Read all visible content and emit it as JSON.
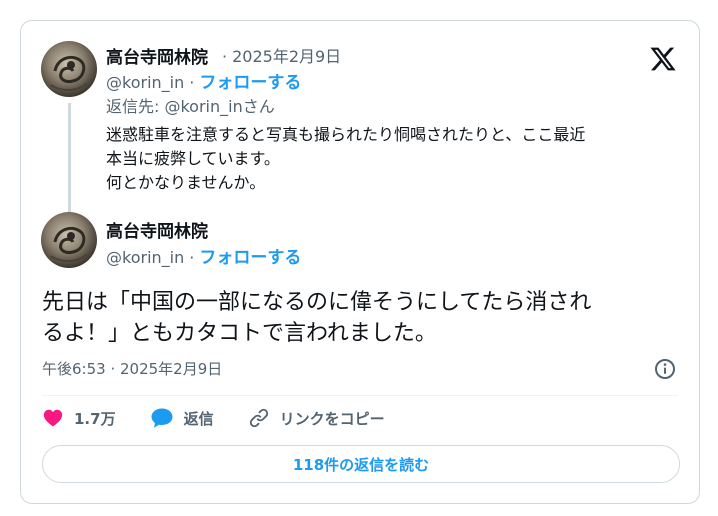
{
  "reply_tweet": {
    "display_name": "高台寺岡林院",
    "date": "2025年2月9日",
    "handle": "@korin_in",
    "follow_label": "フォローする",
    "separator": "·",
    "reply_to": "返信先: @korin_inさん",
    "text_lines": [
      "迷惑駐車を注意すると写真も撮られたり恫喝されたりと、ここ最近",
      "本当に疲弊しています。",
      "何とかなりませんか。"
    ]
  },
  "main_tweet": {
    "display_name": "高台寺岡林院",
    "handle": "@korin_in",
    "follow_label": "フォローする",
    "separator": "·",
    "text_lines": [
      "先日は「中国の一部になるのに偉そうにしてたら消され",
      "るよ！」ともカタコトで言われました。"
    ],
    "timestamp": "午後6:53 · 2025年2月9日"
  },
  "actions": {
    "like_count": "1.7万",
    "reply_label": "返信",
    "copy_link_label": "リンクをコピー"
  },
  "read_replies_label": "118件の返信を読む",
  "icons": {
    "brand": "x-logo-icon",
    "like": "heart-icon",
    "reply": "speech-bubble-icon",
    "copy_link": "link-icon",
    "info": "info-icon"
  },
  "colors": {
    "accent": "#1d9bf0",
    "like": "#f91880",
    "text": "#0f1419",
    "muted": "#536471",
    "border": "#cfd9de"
  }
}
